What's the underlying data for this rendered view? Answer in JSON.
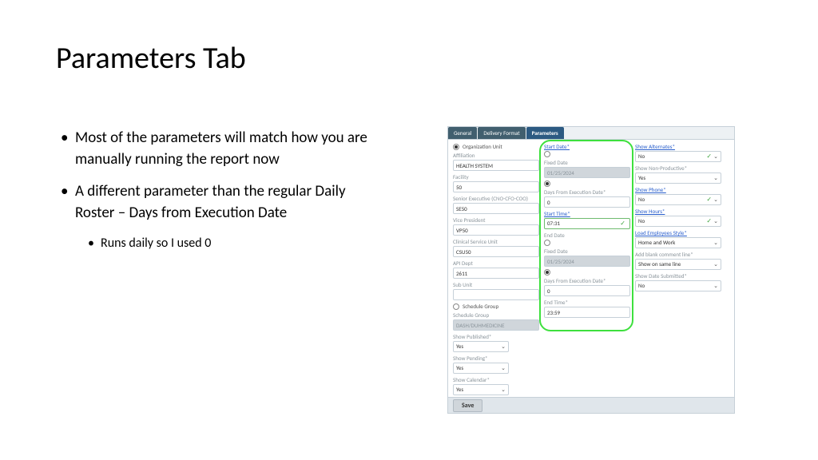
{
  "title": "Parameters Tab",
  "bullets": {
    "b1": "Most of the parameters will match how you are manually running the report now",
    "b2": "A different parameter than the regular Daily Roster – Days from Execution Date",
    "b2a": "Runs daily so I used 0"
  },
  "panel": {
    "tabs": {
      "general": "General",
      "delivery": "Delivery Format",
      "parameters": "Parameters"
    },
    "save": "Save"
  },
  "col1": {
    "org_unit": "Organization Unit",
    "affiliation_label": "Affiliation",
    "affiliation": "HEALTH SYSTEM",
    "facility_label": "Facility",
    "facility": "50",
    "senior_exec_label": "Senior Executive (CNO-CFO-COO)",
    "senior_exec": "SE50",
    "vp_label": "Vice President",
    "vp": "VP50",
    "csu_label": "Clinical Service Unit",
    "csu": "CSU50",
    "api_dept_label": "API Dept",
    "api_dept": "2611",
    "sub_unit_label": "Sub Unit",
    "sub_unit": "",
    "sched_group_radio": "Schedule Group",
    "sched_group_label": "Schedule Group",
    "sched_group": "DASH/DUHMEDICINE",
    "show_published_label": "Show Published*",
    "show_published": "Yes",
    "show_pending_label": "Show Pending*",
    "show_pending": "Yes",
    "show_calendar_label": "Show Calendar*",
    "show_calendar": "Yes"
  },
  "col2": {
    "start_date_label": "Start Date*",
    "fixed_date_label": "Fixed Date",
    "fixed_date": "01/25/2024",
    "days_from_exec_label": "Days From Execution Date*",
    "days_from_exec": "0",
    "start_time_label": "Start Time*",
    "start_time": "07:31",
    "end_date_label": "End Date",
    "fixed_date2_label": "Fixed Date",
    "fixed_date2": "01/25/2024",
    "days_from_exec2_label": "Days From Execution Date*",
    "days_from_exec2": "0",
    "end_time_label": "End Time*",
    "end_time": "23:59"
  },
  "col3": {
    "show_alternates_label": "Show Alternates*",
    "show_alternates": "No",
    "show_nonprod_label": "Show Non-Productive*",
    "show_nonprod": "Yes",
    "show_phone_label": "Show Phone*",
    "show_phone": "No",
    "show_hours_label": "Show Hours*",
    "show_hours": "No",
    "load_emp_label": "Load Employees Style*",
    "load_emp": "Home and Work",
    "add_blank_label": "Add blank comment line*",
    "add_blank": "Show on same line",
    "show_date_sub_label": "Show Date Submitted*",
    "show_date_sub": "No"
  }
}
